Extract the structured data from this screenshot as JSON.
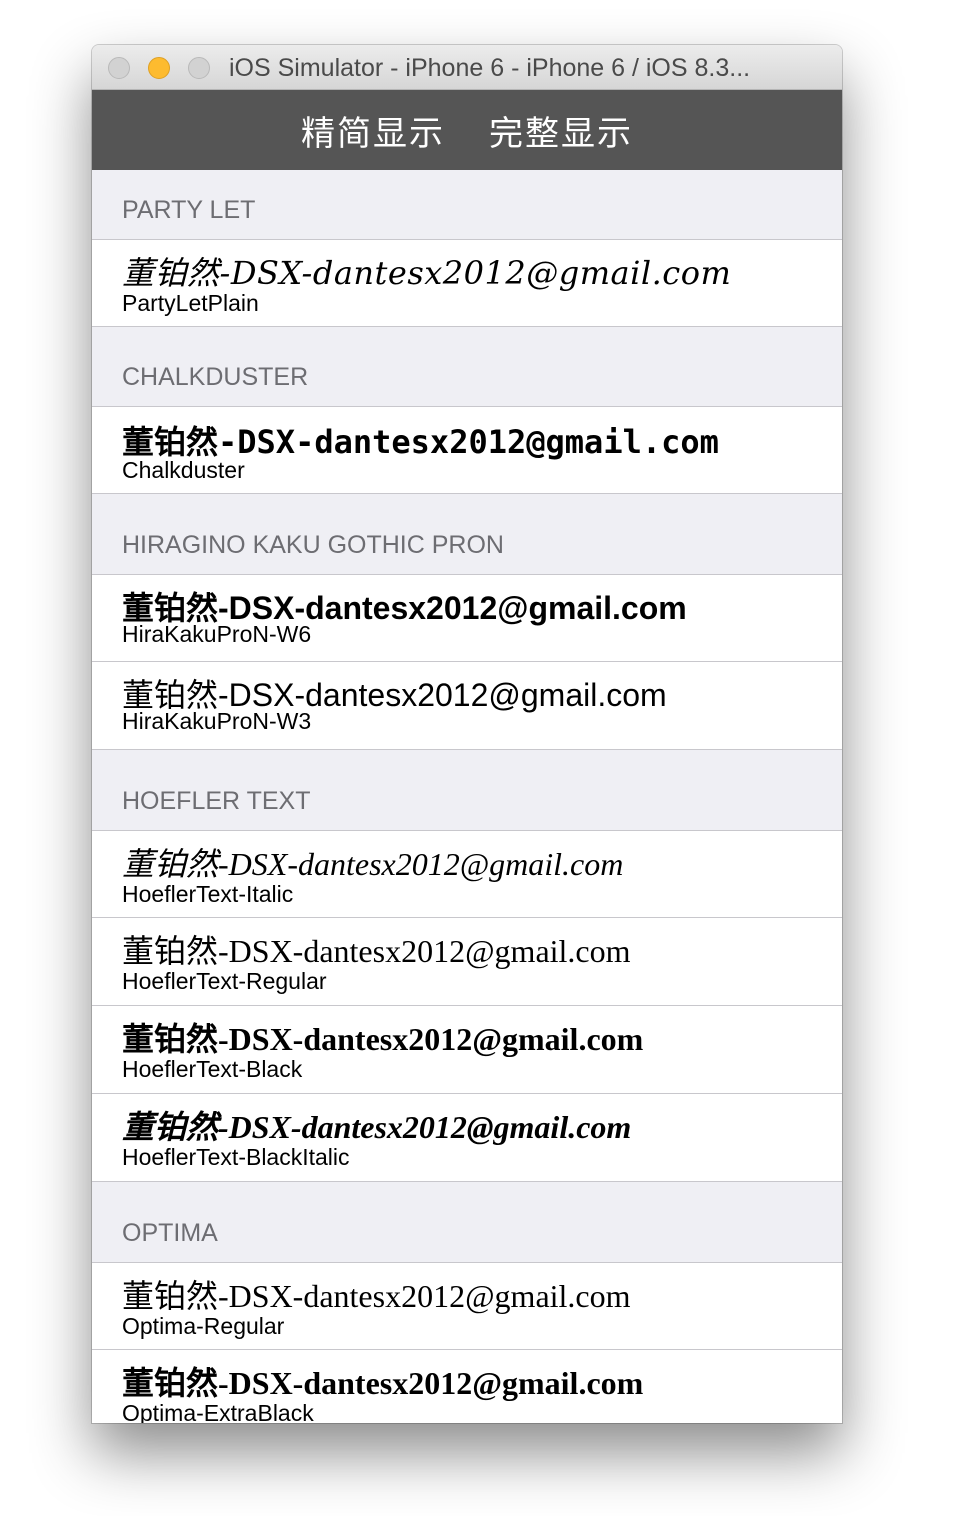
{
  "window": {
    "title": "iOS Simulator - iPhone 6 - iPhone 6 / iOS 8.3..."
  },
  "navbar": {
    "segments": [
      {
        "label": "精简显示"
      },
      {
        "label": "完整显示"
      }
    ]
  },
  "sections": [
    {
      "header": "PARTY LET",
      "rows": [
        {
          "sample": "董铂然-DSX-dantesx2012@gmail.com",
          "font": "PartyLetPlain"
        }
      ]
    },
    {
      "header": "CHALKDUSTER",
      "rows": [
        {
          "sample": "董铂然-DSX-dantesx2012@gmail.com",
          "font": "Chalkduster"
        }
      ]
    },
    {
      "header": "HIRAGINO KAKU GOTHIC PRON",
      "rows": [
        {
          "sample": "董铂然-DSX-dantesx2012@gmail.com",
          "font": "HiraKakuProN-W6"
        },
        {
          "sample": "董铂然-DSX-dantesx2012@gmail.com",
          "font": "HiraKakuProN-W3"
        }
      ]
    },
    {
      "header": "HOEFLER TEXT",
      "rows": [
        {
          "sample": "董铂然-DSX-dantesx2012@gmail.com",
          "font": "HoeflerText-Italic"
        },
        {
          "sample": "董铂然-DSX-dantesx2012@gmail.com",
          "font": "HoeflerText-Regular"
        },
        {
          "sample": "董铂然-DSX-dantesx2012@gmail.com",
          "font": "HoeflerText-Black"
        },
        {
          "sample": "董铂然-DSX-dantesx2012@gmail.com",
          "font": "HoeflerText-BlackItalic"
        }
      ]
    },
    {
      "header": "OPTIMA",
      "rows": [
        {
          "sample": "董铂然-DSX-dantesx2012@gmail.com",
          "font": "Optima-Regular"
        },
        {
          "sample": "董铂然-DSX-dantesx2012@gmail.com",
          "font": "Optima-ExtraBlack"
        }
      ]
    }
  ]
}
